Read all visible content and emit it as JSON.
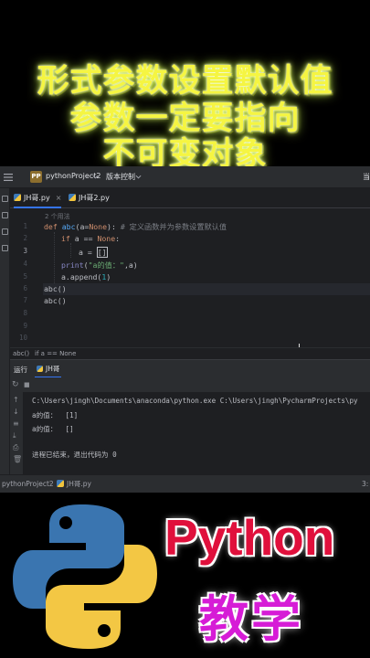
{
  "banner": {
    "line1": "形式参数设置默认值",
    "line2": "参数一定要指向",
    "line3": "不可变对象"
  },
  "ide": {
    "project_badge": "PP",
    "project_name": "pythonProject2",
    "vcs_menu": "版本控制",
    "tabs": [
      {
        "label": "JH哥.py",
        "close": "×"
      },
      {
        "label": "JH哥2.py",
        "close": "×"
      }
    ],
    "usage_hint": "2 个用法",
    "line_numbers": [
      "1",
      "2",
      "3",
      "4",
      "5",
      "6",
      "7",
      "8",
      "9",
      "10"
    ],
    "code": {
      "l1_def": "def ",
      "l1_fn": "abc",
      "l1_args": "(a=",
      "l1_none": "None",
      "l1_rest": "): ",
      "l1_comment": "# 定义函数并为参数设置默认值",
      "l2_if": "if ",
      "l2_cond": "a == ",
      "l2_none": "None",
      "l2_colon": ":",
      "l3_assign": "a = ",
      "l3_list": "[]",
      "l4_print": "print",
      "l4_open": "(",
      "l4_str": "\"a的值：\"",
      "l4_rest": ",a)",
      "l5_text": "a.append(",
      "l5_num": "1",
      "l5_close": ")",
      "l6": "abc()",
      "l7": "abc()"
    },
    "breadcrumbs": [
      "abc()",
      "if a == None"
    ],
    "run_label": "运行",
    "run_tab": "JH哥",
    "console": {
      "cmd": "C:\\Users\\jingh\\Documents\\anaconda\\python.exe C:\\Users\\jingh\\PycharmProjects\\py",
      "out1": "a的值：  [1]",
      "out2": "a的值：  []",
      "exit": "进程已结束，退出代码为 0"
    },
    "status": {
      "project": "pythonProject2",
      "file": "JH哥.py",
      "position": "3:"
    },
    "truncated_right": "当"
  },
  "brand": {
    "python_word": "Python",
    "teach_word": "教学"
  }
}
